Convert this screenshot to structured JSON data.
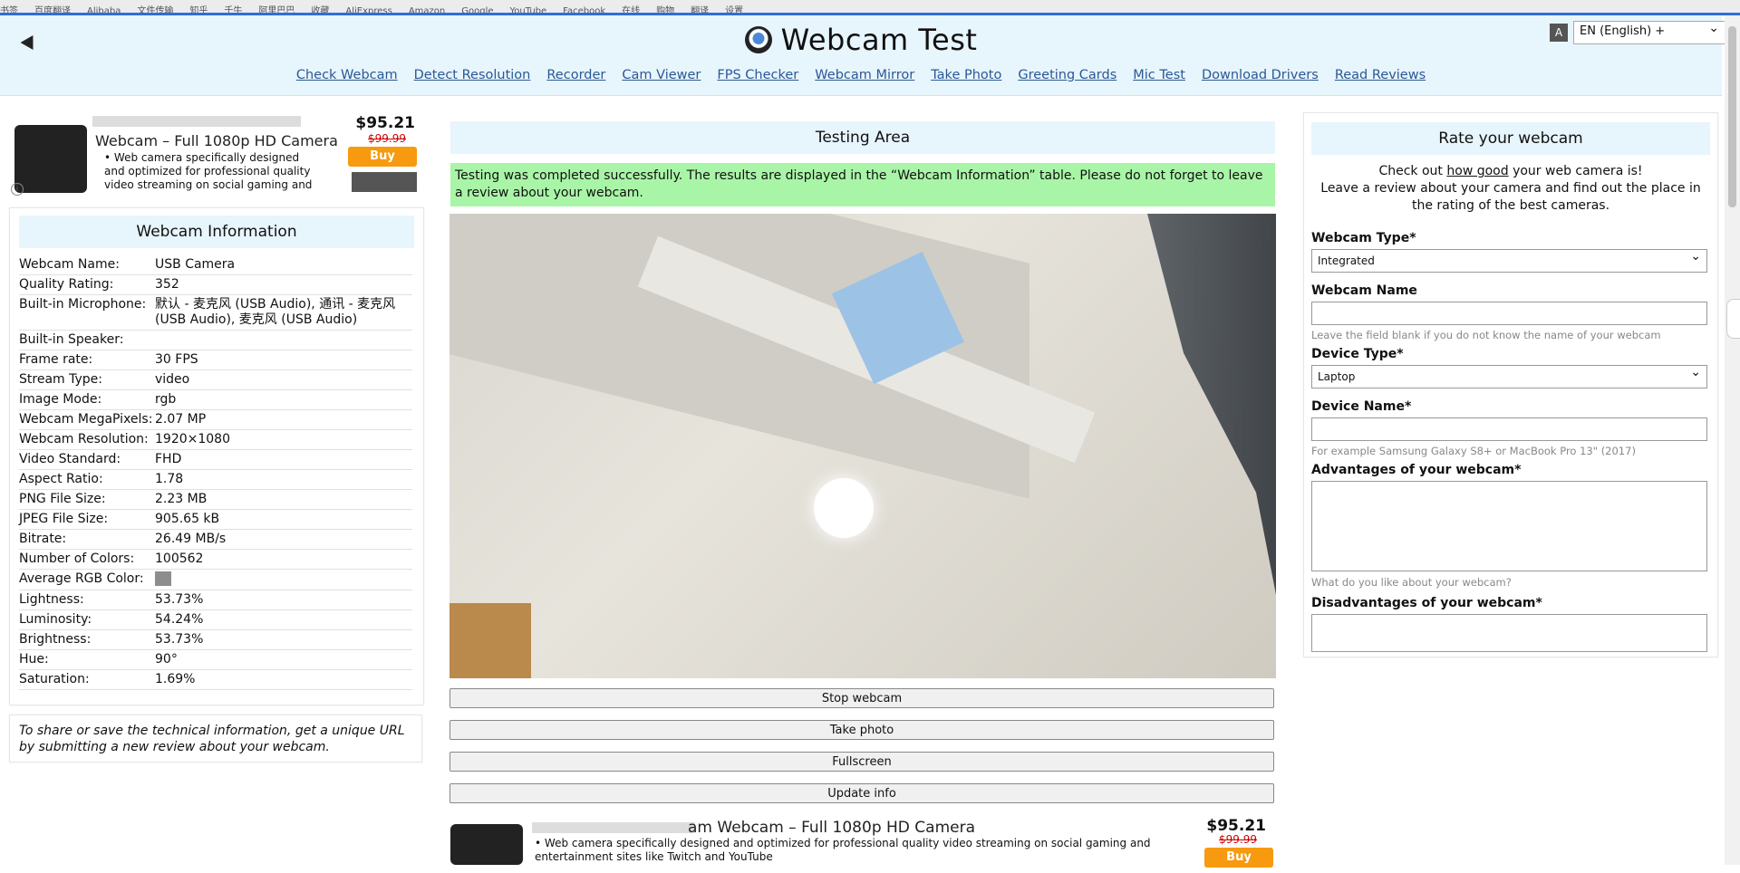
{
  "bookmarks": [
    "书签",
    "百度翻译",
    "Alibaba",
    "文件传输",
    "知乎",
    "千牛",
    "阿里巴巴",
    "收藏",
    "AliExpress",
    "Amazon",
    "Google",
    "YouTube",
    "Facebook",
    "在线",
    "购物",
    "翻译",
    "设置"
  ],
  "header": {
    "title": "Webcam Test",
    "nav": [
      "Check Webcam",
      "Detect Resolution",
      "Recorder",
      "Cam Viewer",
      "FPS Checker",
      "Webcam Mirror",
      "Take Photo",
      "Greeting Cards",
      "Mic Test",
      "Download Drivers",
      "Read Reviews"
    ],
    "language": "EN (English) +"
  },
  "ad_left": {
    "title": "Webcam – Full 1080p HD Camera",
    "desc": "Web camera specifically designed and optimized for professional quality video streaming on social gaming and",
    "price": "$95.21",
    "old_price": "$99.99",
    "buy": "Buy"
  },
  "webcam_info": {
    "heading": "Webcam Information",
    "rows": [
      {
        "k": "Webcam Name:",
        "v": "USB Camera"
      },
      {
        "k": "Quality Rating:",
        "v": "352"
      },
      {
        "k": "Built-in Microphone:",
        "v": "默认 - 麦克风 (USB Audio), 通讯 - 麦克风 (USB Audio), 麦克风 (USB Audio)"
      },
      {
        "k": "Built-in Speaker:",
        "v": ""
      },
      {
        "k": "Frame rate:",
        "v": "30 FPS"
      },
      {
        "k": "Stream Type:",
        "v": "video"
      },
      {
        "k": "Image Mode:",
        "v": "rgb"
      },
      {
        "k": "Webcam MegaPixels:",
        "v": "2.07 MP"
      },
      {
        "k": "Webcam Resolution:",
        "v": "1920×1080"
      },
      {
        "k": "Video Standard:",
        "v": "FHD"
      },
      {
        "k": "Aspect Ratio:",
        "v": "1.78"
      },
      {
        "k": "PNG File Size:",
        "v": "2.23 MB"
      },
      {
        "k": "JPEG File Size:",
        "v": "905.65 kB"
      },
      {
        "k": "Bitrate:",
        "v": "26.49 MB/s"
      },
      {
        "k": "Number of Colors:",
        "v": "100562"
      },
      {
        "k": "Average RGB Color:",
        "v": ""
      },
      {
        "k": "Lightness:",
        "v": "53.73%"
      },
      {
        "k": "Luminosity:",
        "v": "54.24%"
      },
      {
        "k": "Brightness:",
        "v": "53.73%"
      },
      {
        "k": "Hue:",
        "v": "90°"
      },
      {
        "k": "Saturation:",
        "v": "1.69%"
      }
    ],
    "avg_color": "#8d8d8d",
    "share_note": "To share or save the technical information, get a unique URL by submitting a new review about your webcam."
  },
  "testing": {
    "heading": "Testing Area",
    "success": "Testing was completed successfully. The results are displayed in the “Webcam Information” table. Please do not forget to leave a review about your webcam.",
    "buttons": [
      "Stop webcam",
      "Take photo",
      "Fullscreen",
      "Update info"
    ]
  },
  "ad_mid": {
    "title": "am Webcam – Full 1080p HD Camera",
    "desc": "Web camera specifically designed and optimized for professional quality video streaming on social gaming and entertainment sites like Twitch and YouTube",
    "price": "$95.21",
    "old_price": "$99.99",
    "buy": "Buy"
  },
  "rate": {
    "heading": "Rate your webcam",
    "intro_1": "Check out",
    "intro_link": "how good",
    "intro_2": "your web camera is!",
    "intro_3": "Leave a review about your camera and find out the place in the rating of the best cameras.",
    "type_label": "Webcam Type*",
    "type_value": "Integrated",
    "name_label": "Webcam Name",
    "name_hint": "Leave the field blank if you do not know the name of your webcam",
    "device_type_label": "Device Type*",
    "device_type_value": "Laptop",
    "device_name_label": "Device Name*",
    "device_name_hint": "For example Samsung Galaxy S8+ or MacBook Pro 13\" (2017)",
    "adv_label": "Advantages of your webcam*",
    "adv_hint": "What do you like about your webcam?",
    "dis_label": "Disadvantages of your webcam*"
  }
}
